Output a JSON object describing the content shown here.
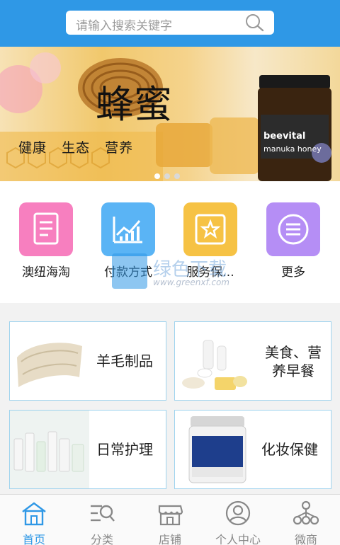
{
  "search": {
    "placeholder": "请输入搜索关键字"
  },
  "banner": {
    "tag1": "健康",
    "tag2": "生态",
    "tag3": "营养",
    "calligraphy": "蜂蜜",
    "product_brand": "beevital",
    "product_name": "manuka honey",
    "active_slide": 1,
    "slide_count": 3
  },
  "categories": [
    {
      "label": "澳纽海淘",
      "icon": "document-icon",
      "color": "#f77fbf"
    },
    {
      "label": "付款方式",
      "icon": "chart-icon",
      "color": "#5ab4f5"
    },
    {
      "label": "服务保...",
      "icon": "star-icon",
      "color": "#f6c244"
    },
    {
      "label": "更多",
      "icon": "menu-icon",
      "color": "#b58ef5"
    }
  ],
  "watermark": {
    "text": "绿色下载",
    "url": "www.greenxf.com",
    "logo_text": "GREENXF .COM"
  },
  "products": [
    {
      "title": "羊毛制品"
    },
    {
      "title": "美食、营养早餐"
    },
    {
      "title": "日常护理"
    },
    {
      "title": "化妆保健"
    }
  ],
  "tabs": [
    {
      "label": "首页",
      "icon": "home-icon",
      "active": true
    },
    {
      "label": "分类",
      "icon": "category-search-icon",
      "active": false
    },
    {
      "label": "店铺",
      "icon": "store-icon",
      "active": false
    },
    {
      "label": "个人中心",
      "icon": "user-icon",
      "active": false
    },
    {
      "label": "微商",
      "icon": "network-icon",
      "active": false
    }
  ],
  "colors": {
    "primary": "#2f98e6",
    "card_border": "#9fd3ee"
  }
}
